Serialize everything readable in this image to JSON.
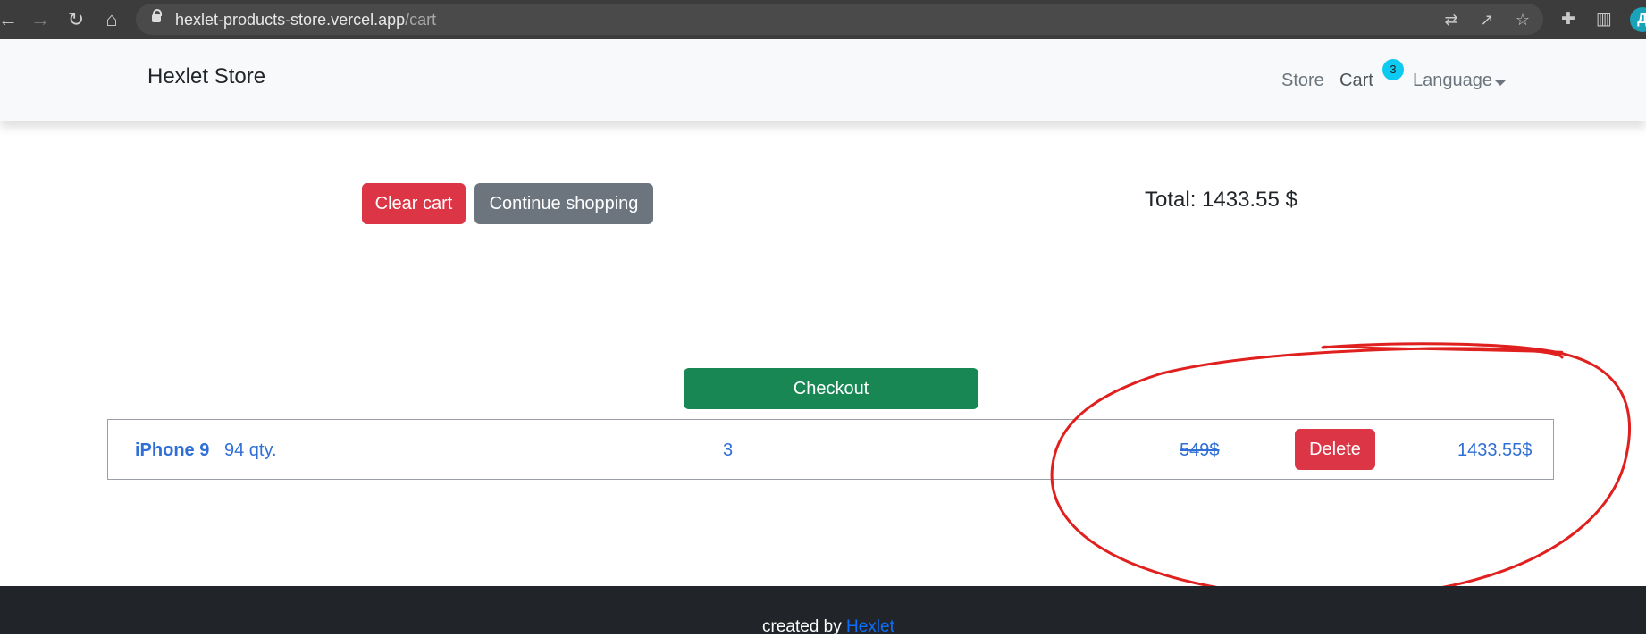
{
  "browser": {
    "url_host": "hexlet-products-store.vercel.app",
    "url_path": "/cart",
    "profile_initial": "Д"
  },
  "navbar": {
    "brand": "Hexlet Store",
    "links": {
      "store": "Store",
      "cart": "Cart",
      "language": "Language"
    },
    "cart_badge": "3"
  },
  "actions": {
    "clear_cart": "Clear cart",
    "continue_shopping": "Continue shopping",
    "checkout": "Checkout"
  },
  "summary": {
    "total": "Total: 1433.55 $"
  },
  "cart_items": [
    {
      "name": "iPhone 9",
      "stock": "94 qty.",
      "quantity": "3",
      "price": "549$",
      "delete_label": "Delete",
      "line_total": "1433.55$"
    }
  ],
  "footer": {
    "text": "created by ",
    "link": "Hexlet"
  },
  "colors": {
    "danger": "#dc3545",
    "secondary": "#6c757d",
    "success": "#198754",
    "link": "#2f6fd6",
    "badge": "#0dcaf0",
    "annotation": "#e0201e"
  }
}
